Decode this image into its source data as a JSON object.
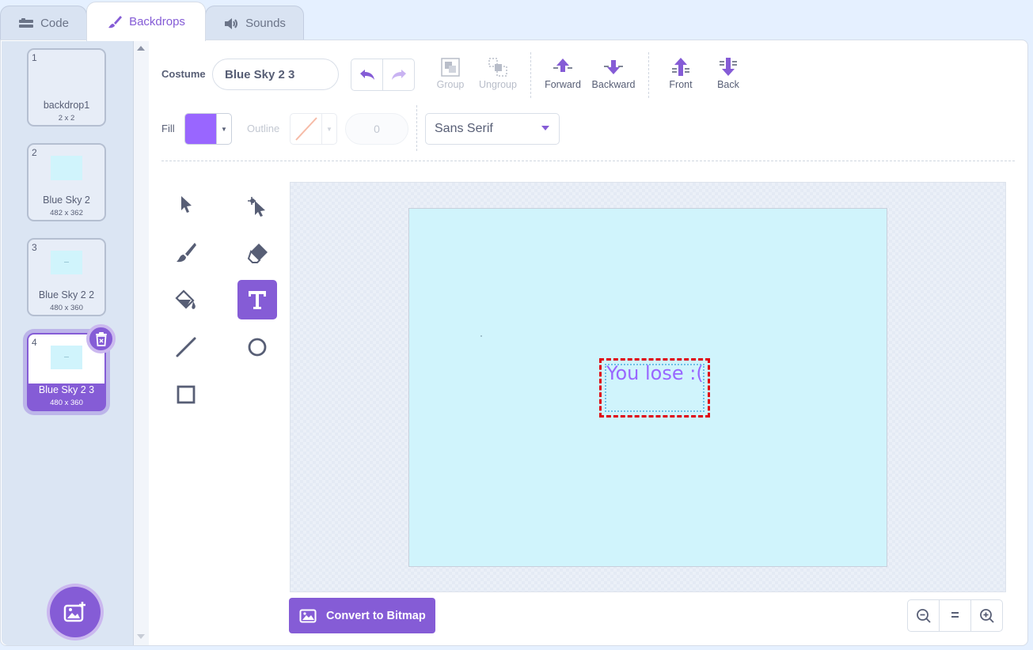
{
  "tabs": [
    {
      "label": "Code",
      "icon": "code-icon"
    },
    {
      "label": "Backdrops",
      "icon": "paintbrush-icon",
      "active": true
    },
    {
      "label": "Sounds",
      "icon": "speaker-icon"
    }
  ],
  "backdrops": [
    {
      "number": "1",
      "name": "backdrop1",
      "size": "2 x 2"
    },
    {
      "number": "2",
      "name": "Blue Sky 2",
      "size": "482 x 362"
    },
    {
      "number": "3",
      "name": "Blue Sky 2 2",
      "size": "480 x 360"
    },
    {
      "number": "4",
      "name": "Blue Sky 2 3",
      "size": "480 x 360",
      "selected": true
    }
  ],
  "toolbar": {
    "costume_label": "Costume",
    "costume_name": "Blue Sky 2 3",
    "group_label": "Group",
    "ungroup_label": "Ungroup",
    "forward_label": "Forward",
    "backward_label": "Backward",
    "front_label": "Front",
    "back_label": "Back",
    "fill_label": "Fill",
    "fill_color": "#9966ff",
    "outline_label": "Outline",
    "outline_width": "0",
    "font": "Sans Serif"
  },
  "tools": [
    "select",
    "reshape",
    "brush",
    "eraser",
    "fill",
    "text",
    "line",
    "circle",
    "rectangle"
  ],
  "active_tool": "text",
  "canvas": {
    "text": "You lose :(",
    "stage_color": "#d0f4fc"
  },
  "convert_label": "Convert to Bitmap",
  "zoom": {
    "equal_label": "="
  },
  "colors": {
    "accent": "#855cd6",
    "selection": "#e0000f"
  }
}
